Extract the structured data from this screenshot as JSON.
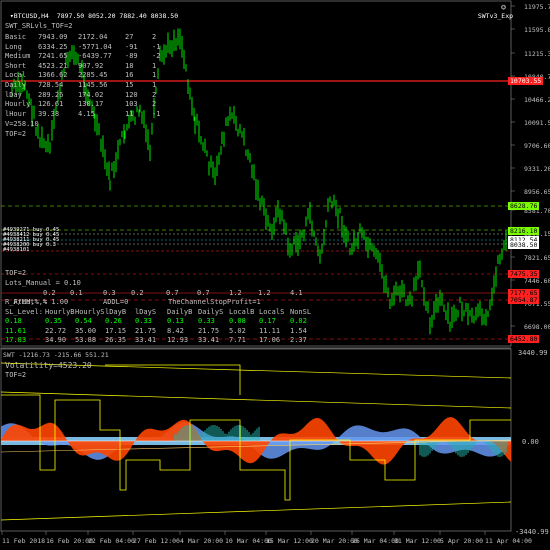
{
  "header": {
    "symbol_line": "BTCUSD,H4  7897.50 8052.20 7882.40 8038.50",
    "expert_name": "SWTv3_Exp"
  },
  "indicator_panel": {
    "title": "SWT_SRLvls_TOF=2",
    "rows": [
      {
        "name": "Basic",
        "v1": "7943.09",
        "v2": "2172.04",
        "v3": "27",
        "v4": "2"
      },
      {
        "name": "Long",
        "v1": "6334.25",
        "v2": "-5771.04",
        "v3": "-91",
        "v4": "-1"
      },
      {
        "name": "Medium",
        "v1": "7241.65",
        "v2": "-6439.77",
        "v3": "-89",
        "v4": "-2"
      },
      {
        "name": "Short",
        "v1": "4523.21",
        "v2": "907.92",
        "v3": "18",
        "v4": "1"
      },
      {
        "name": "Local",
        "v1": "1366.62",
        "v2": "2285.45",
        "v3": "16",
        "v4": "1"
      },
      {
        "name": "Daily",
        "v1": "728.54",
        "v2": "1145.56",
        "v3": "15",
        "v4": "1"
      },
      {
        "name": "lDay",
        "v1": "289.26",
        "v2": "174.02",
        "v3": "120",
        "v4": "2"
      },
      {
        "name": "Hourly",
        "v1": "126.61",
        "v2": "130.17",
        "v3": "103",
        "v4": "2"
      },
      {
        "name": "lHour",
        "v1": "39.38",
        "v2": "4.15",
        "v3": "11",
        "v4": "-1"
      }
    ],
    "v_line": "V=258.10",
    "tof_line": "TOF=2"
  },
  "bottom_info": {
    "tof": "TOF=2",
    "lots": "Lots_Manual = 0.10",
    "factor_label": "F/Lot%,%",
    "factor_values": [
      "0.2",
      "0.1",
      "0.3",
      "0.2",
      "0.7",
      "0.7",
      "1.2",
      "1.2",
      "4.1"
    ],
    "r_label": "R_AtMM,% = 1.00",
    "addl": "ADDL=0",
    "channel": "TheChannelStopProfit=1",
    "sl_headers": [
      "SL_Level:",
      "HourlyB",
      "HourlyS",
      "lDayB",
      "lDayS",
      "DailyB",
      "DailyS",
      "LocalB",
      "LocalS",
      "NonSL"
    ],
    "row1": [
      "0.18",
      "0.35",
      "0.54",
      "0.26",
      "0.33",
      "0.13",
      "0.33",
      "0.08",
      "0.17",
      "0.02"
    ],
    "row2": [
      "11.61",
      "22.72",
      "35.00",
      "17.15",
      "21.75",
      "8.42",
      "21.75",
      "5.02",
      "11.11",
      "1.54"
    ],
    "row3": [
      "17.83",
      "34.90",
      "53.88",
      "26.35",
      "33.41",
      "12.93",
      "33.41",
      "7.71",
      "17.06",
      "2.37"
    ]
  },
  "order_labels": [
    "#4939271 buy 0.45",
    "#4938412 buy 0.45",
    "#4938211 buy 0.45",
    "#4938200 buy 0.3",
    "#4938101"
  ],
  "price_axis": {
    "labels": [
      "11975.70",
      "11595.80",
      "11215.30",
      "10840.70",
      "10466.20",
      "10091.55",
      "9706.60",
      "9331.20",
      "8956.65",
      "8581.70",
      "8206.15",
      "7821.65",
      "7446.60",
      "7071.55",
      "6698.00"
    ],
    "tags": [
      {
        "text": "10703.55",
        "bg": "#ff2020",
        "fg": "#ffffff"
      },
      {
        "text": "8628.76",
        "bg": "#7cfc00",
        "fg": "#000000"
      },
      {
        "text": "8216.10",
        "bg": "#7cfc00",
        "fg": "#000000"
      },
      {
        "text": "8112.54",
        "bg": "#ffffff",
        "fg": "#000000"
      },
      {
        "text": "8038.50",
        "bg": "#ffffff",
        "fg": "#000000"
      },
      {
        "text": "7475.35",
        "bg": "#ff2020",
        "fg": "#000000"
      },
      {
        "text": "7177.65",
        "bg": "#ff2020",
        "fg": "#000000"
      },
      {
        "text": "7054.87",
        "bg": "#ff2020",
        "fg": "#000000"
      },
      {
        "text": "6452.80",
        "bg": "#ff2020",
        "fg": "#000000"
      }
    ]
  },
  "sub_panel": {
    "title": "SWT -1216.73 -215.66 551.21",
    "volatility": "Volatility=4523.20",
    "tof": "TOF=2",
    "axis_labels": [
      "3440.99",
      "0.00",
      "-3440.99"
    ]
  },
  "time_axis": {
    "labels": [
      "11 Feb 2018",
      "16 Feb 20:00",
      "22 Feb 04:00",
      "27 Feb 12:00",
      "4 Mar 20:00",
      "10 Mar 04:00",
      "15 Mar 12:00",
      "20 Mar 20:00",
      "26 Mar 04:00",
      "31 Mar 12:00",
      "5 Apr 20:00",
      "11 Apr 04:00"
    ]
  },
  "colors": {
    "candle": "#00ff00",
    "red_line": "#ff2020",
    "green_line": "#7cfc00",
    "yellow": "#ffff00",
    "orange": "#ff4500",
    "steel": "#6495ed",
    "teal": "#20b2aa"
  }
}
